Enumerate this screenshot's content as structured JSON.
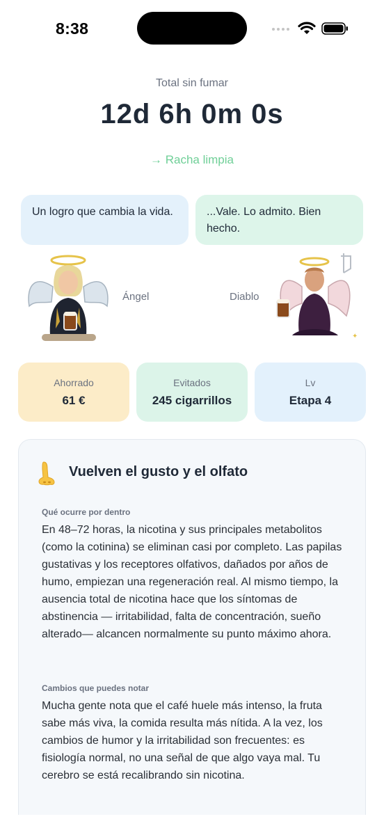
{
  "status": {
    "time": "8:38"
  },
  "timer": {
    "label": "Total sin fumar",
    "value": "12d 6h 0m 0s",
    "streak": "→ Racha limpia"
  },
  "messages": {
    "angel": "Un logro que cambia la vida.",
    "devil": "...Vale. Lo admito. Bien hecho."
  },
  "characters": {
    "angel_label": "Ángel",
    "devil_label": "Diablo"
  },
  "stats": [
    {
      "label": "Ahorrado",
      "value": "61 €"
    },
    {
      "label": "Evitados",
      "value": "245 cigarrillos"
    },
    {
      "label": "Lv",
      "value": "Etapa 4"
    }
  ],
  "milestone": {
    "icon": "nose-icon",
    "title": "Vuelven el gusto y el olfato",
    "sections": [
      {
        "label": "Qué ocurre por dentro",
        "text": "En 48–72 horas, la nicotina y sus principales metabolitos (como la cotinina) se eliminan casi por completo. Las papilas gustativas y los receptores olfativos, dañados por años de humo, empiezan una regeneración real. Al mismo tiempo, la ausencia total de nicotina hace que los síntomas de abstinencia — irritabilidad, falta de concentración, sueño alterado— alcancen normalmente su punto máximo ahora."
      },
      {
        "label": "Cambios que puedes notar",
        "text": "Mucha gente nota que el café huele más intenso, la fruta sabe más viva, la comida resulta más nítida. A la vez, los cambios de humor y la irritabilidad son frecuentes: es fisiología normal, no una señal de que algo vaya mal. Tu cerebro se está recalibrando sin nicotina."
      }
    ]
  },
  "colors": {
    "accent_green": "#6fcf97",
    "saved_bg": "#fcecc8",
    "avoided_bg": "#dcf4e9",
    "level_bg": "#e3f1fc"
  }
}
